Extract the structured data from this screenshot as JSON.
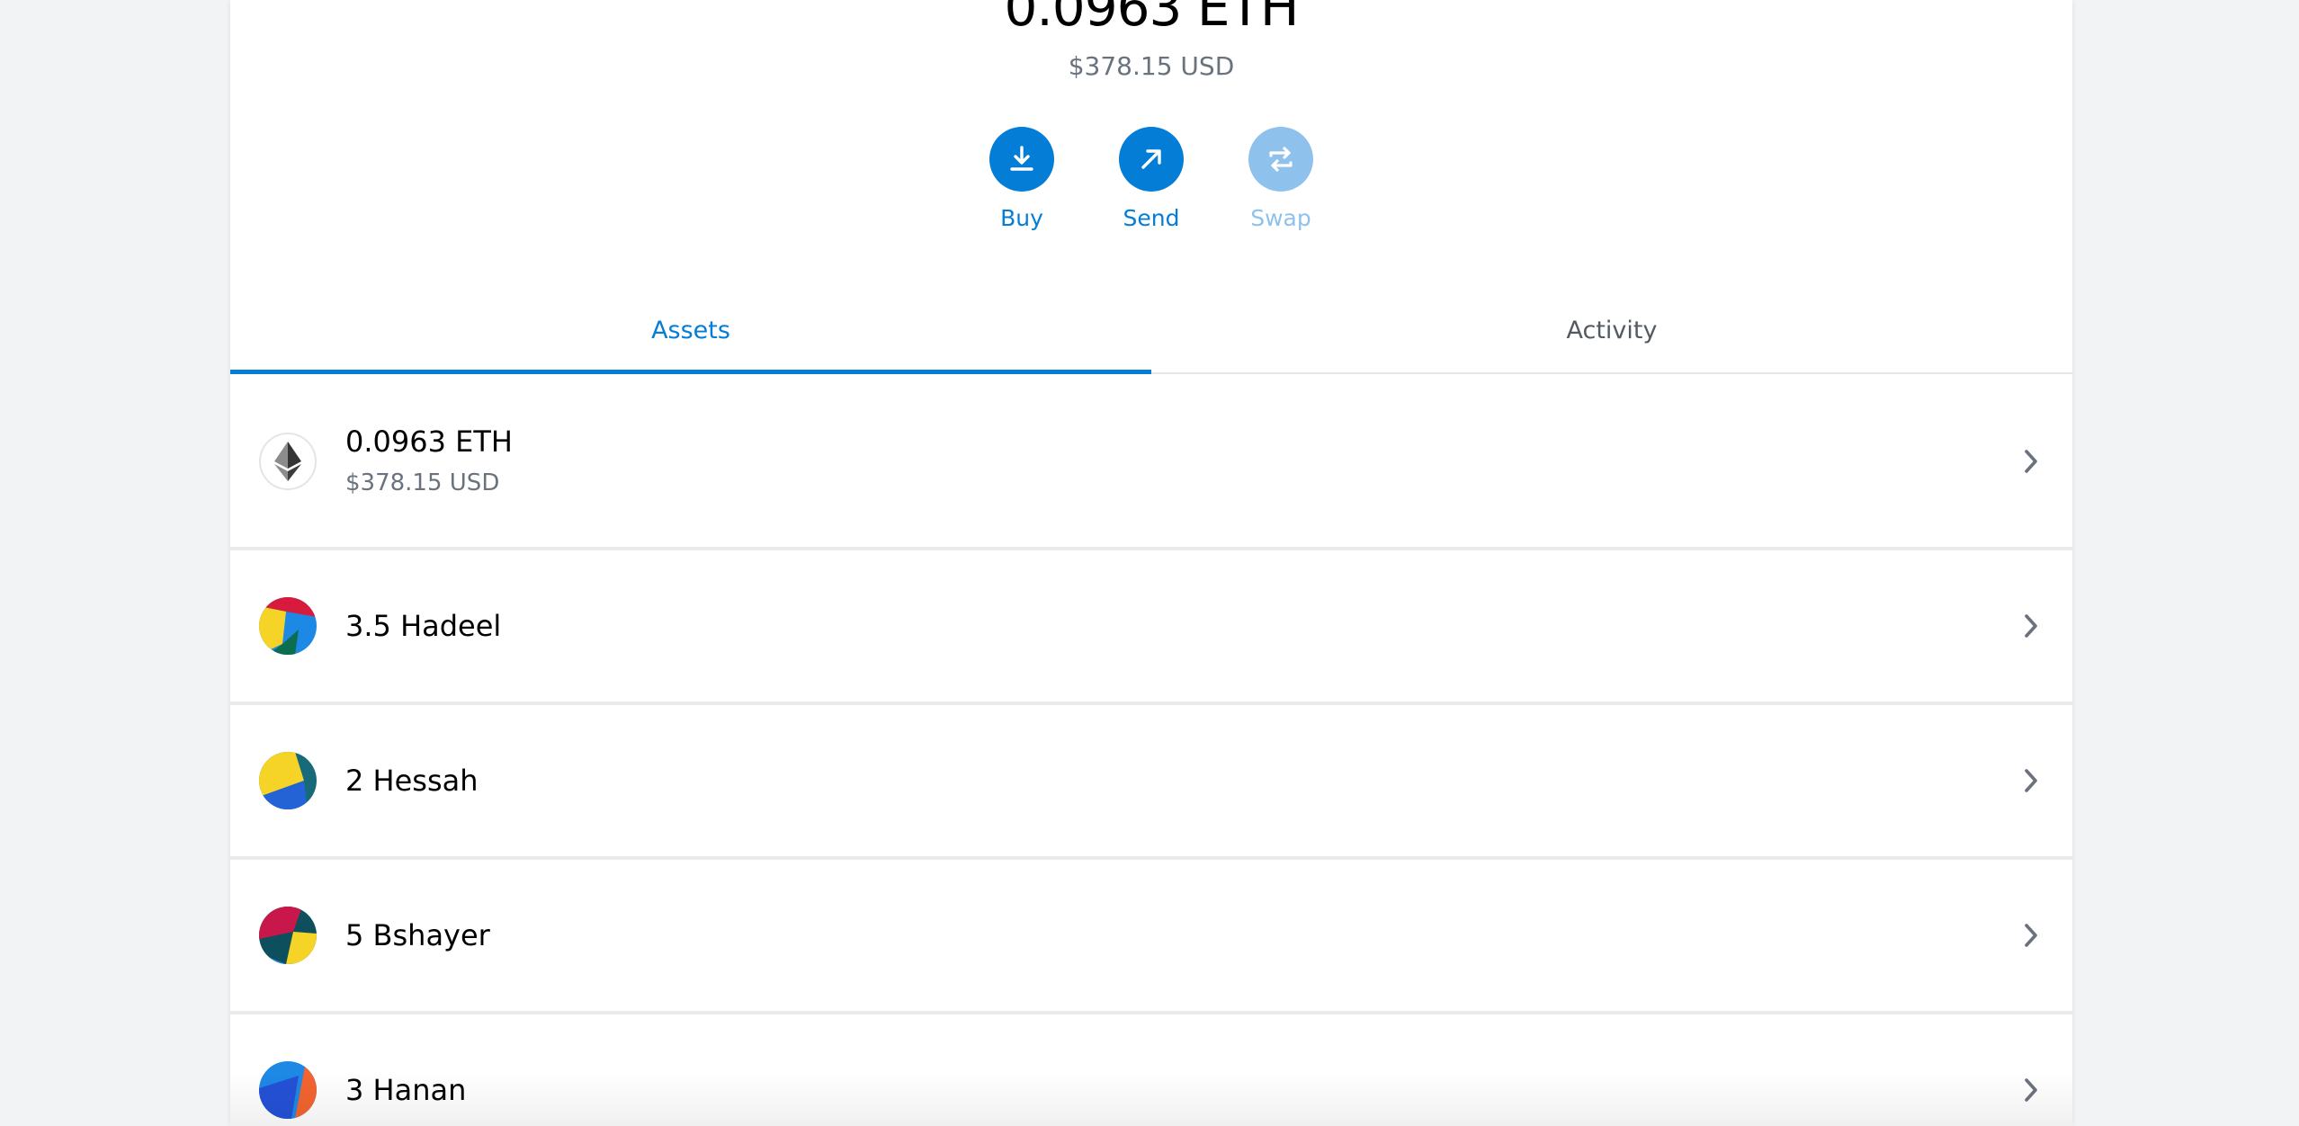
{
  "overview": {
    "balance": "0.0963 ETH",
    "balance_fiat": "$378.15 USD"
  },
  "actions": [
    {
      "label": "Buy",
      "icon": "download-icon",
      "enabled": true
    },
    {
      "label": "Send",
      "icon": "arrow-up-right-icon",
      "enabled": true
    },
    {
      "label": "Swap",
      "icon": "swap-icon",
      "enabled": false
    }
  ],
  "tabs": [
    {
      "label": "Assets",
      "active": true
    },
    {
      "label": "Activity",
      "active": false
    }
  ],
  "assets": [
    {
      "primary": "0.0963 ETH",
      "secondary": "$378.15 USD",
      "icon": "ethereum-icon"
    },
    {
      "primary": "3.5 Hadeel",
      "icon": "token-identicon"
    },
    {
      "primary": "2 Hessah",
      "icon": "token-identicon"
    },
    {
      "primary": "5 Bshayer",
      "icon": "token-identicon"
    },
    {
      "primary": "3 Hanan",
      "icon": "token-identicon"
    }
  ],
  "colors": {
    "accent": "#037dd6",
    "accent_disabled": "#8ec2ec",
    "muted_text": "#6a737d"
  }
}
